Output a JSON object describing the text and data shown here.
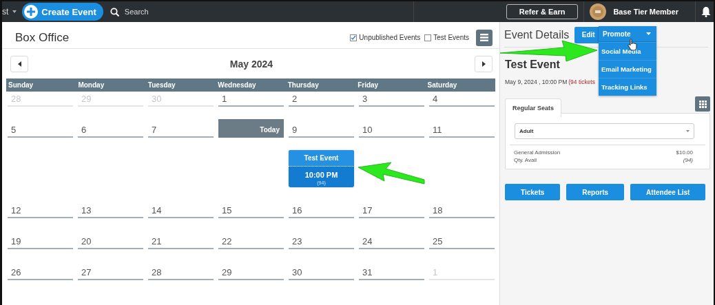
{
  "top_bar": {
    "account_menu": "st",
    "create_button": "Create Event",
    "search": {
      "placeholder": "Search"
    },
    "refer_button": "Refer & Earn",
    "member_label": "Base Tier Member"
  },
  "box_office": {
    "title": "Box Office",
    "filters": [
      {
        "label": "Unpublished Events",
        "checked": true
      },
      {
        "label": "Test Events",
        "checked": false
      }
    ],
    "month": "May 2024",
    "weekdays": [
      "Sunday",
      "Monday",
      "Tuesday",
      "Wednesday",
      "Thursday",
      "Friday",
      "Saturday"
    ],
    "weeks": [
      [
        {
          "day": "28",
          "in_month": false
        },
        {
          "day": "29",
          "in_month": false
        },
        {
          "day": "30",
          "in_month": false
        },
        {
          "day": "1",
          "in_month": true
        },
        {
          "day": "2",
          "in_month": true
        },
        {
          "day": "3",
          "in_month": true
        },
        {
          "day": "4",
          "in_month": true
        }
      ],
      [
        {
          "day": "5",
          "in_month": true
        },
        {
          "day": "6",
          "in_month": true
        },
        {
          "day": "7",
          "in_month": true
        },
        {
          "label": "Today",
          "in_month": true,
          "today": true
        },
        {
          "day": "9",
          "in_month": true,
          "events": [
            {
              "title": "Test Event",
              "time": "10:00 PM",
              "count": "(94)"
            }
          ]
        },
        {
          "day": "10",
          "in_month": true
        },
        {
          "day": "11",
          "in_month": true
        }
      ],
      [
        {
          "day": "12",
          "in_month": true
        },
        {
          "day": "13",
          "in_month": true
        },
        {
          "day": "14",
          "in_month": true
        },
        {
          "day": "15",
          "in_month": true
        },
        {
          "day": "16",
          "in_month": true
        },
        {
          "day": "17",
          "in_month": true
        },
        {
          "day": "18",
          "in_month": true
        }
      ],
      [
        {
          "day": "19",
          "in_month": true
        },
        {
          "day": "20",
          "in_month": true
        },
        {
          "day": "21",
          "in_month": true
        },
        {
          "day": "22",
          "in_month": true
        },
        {
          "day": "23",
          "in_month": true
        },
        {
          "day": "24",
          "in_month": true
        },
        {
          "day": "25",
          "in_month": true
        }
      ],
      [
        {
          "day": "26",
          "in_month": true
        },
        {
          "day": "27",
          "in_month": true
        },
        {
          "day": "28",
          "in_month": true
        },
        {
          "day": "29",
          "in_month": true
        },
        {
          "day": "30",
          "in_month": true
        },
        {
          "day": "31",
          "in_month": true
        },
        {
          "day": "1",
          "in_month": false
        }
      ]
    ]
  },
  "event_details": {
    "title": "Event Details",
    "edit_button": "Edit",
    "promote": {
      "label": "Promote",
      "expanded": true,
      "items": [
        "Social Media",
        "Email Marketing",
        "Tracking Links"
      ]
    },
    "event_title": "Test Event",
    "date": "May 9, 2024 , 10:00 PM",
    "tickets": "(94 tickets",
    "tabs": [
      {
        "label": "Regular Seats",
        "selected": true
      }
    ],
    "ticket_type": "Adult",
    "ticket_lines": [
      {
        "name": "General Admission",
        "value": "$10.00"
      },
      {
        "name": "Qty. Avail",
        "value": "(94)"
      }
    ],
    "buttons": [
      "Tickets",
      "Reports",
      "Attendee List"
    ]
  }
}
